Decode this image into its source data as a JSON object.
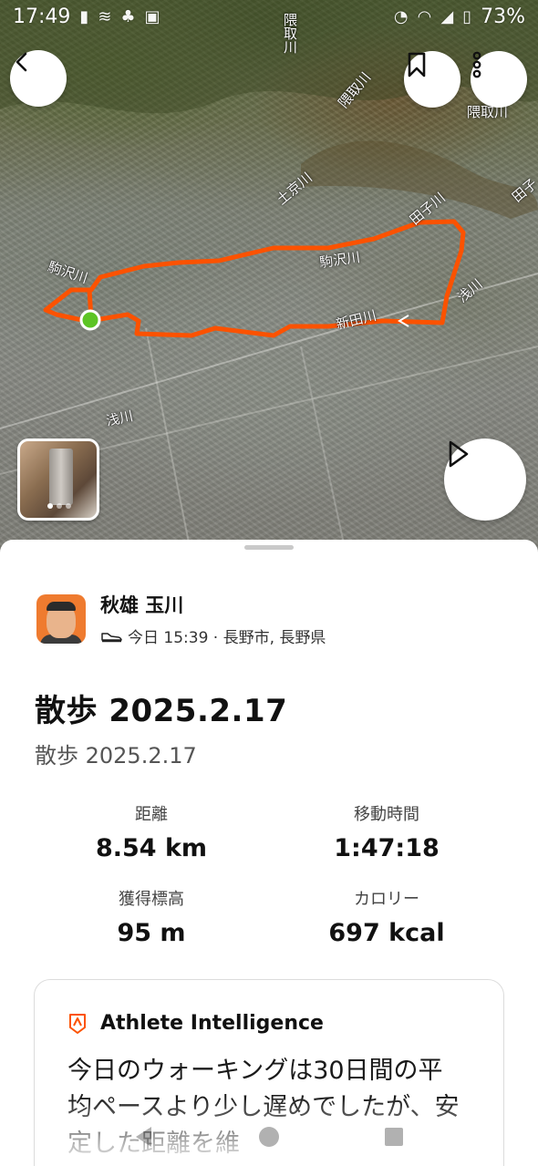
{
  "status_bar": {
    "time": "17:49",
    "battery": "73%",
    "left_icons": [
      "sim-icon",
      "signal-icon",
      "notification-icon",
      "image-icon"
    ],
    "right_icons": [
      "alarm-icon",
      "wifi-icon",
      "mobile-signal-icon",
      "battery-icon"
    ]
  },
  "map": {
    "buttons": {
      "back": "back-icon",
      "bookmark": "bookmark-icon",
      "more": "more-icon",
      "play": "play-icon"
    },
    "labels": [
      {
        "id": "label-1",
        "text": "隈取川"
      },
      {
        "id": "label-2",
        "text": "隈取川"
      },
      {
        "id": "label-3",
        "text": "隈取川"
      },
      {
        "id": "label-4",
        "text": "土京川"
      },
      {
        "id": "label-5",
        "text": "田子川"
      },
      {
        "id": "label-6",
        "text": "駒沢川"
      },
      {
        "id": "label-7",
        "text": "駒沢川"
      },
      {
        "id": "label-8",
        "text": "浅川"
      },
      {
        "id": "label-9",
        "text": "新田川"
      },
      {
        "id": "label-10",
        "text": "浅川"
      },
      {
        "id": "label-11",
        "text": "田子"
      }
    ],
    "route_color": "#fc5200",
    "start_marker_color": "#5cc424",
    "photo_pages": 3,
    "photo_page_current": 1
  },
  "activity": {
    "athlete_name": "秋雄 玉川",
    "meta": "今日 15:39 · 長野市, 長野県",
    "activity_icon": "shoe-icon",
    "title": "散歩 2025.2.17",
    "subtitle": "散歩 2025.2.17",
    "stats": [
      {
        "label": "距離",
        "value": "8.54 km"
      },
      {
        "label": "移動時間",
        "value": "1:47:18"
      },
      {
        "label": "獲得標高",
        "value": "95 m"
      },
      {
        "label": "カロリー",
        "value": "697 kcal"
      }
    ]
  },
  "athlete_intelligence": {
    "icon": "athlete-intelligence-icon",
    "title": "Athlete Intelligence",
    "text": "今日のウォーキングは30日間の平均ペースより少し遅めでしたが、安定した距離を維"
  },
  "nav": {
    "back": "nav-back-icon",
    "home": "nav-home-icon",
    "recents": "nav-recents-icon"
  },
  "colors": {
    "accent": "#fc5200",
    "text": "#111111",
    "muted": "#555555"
  }
}
